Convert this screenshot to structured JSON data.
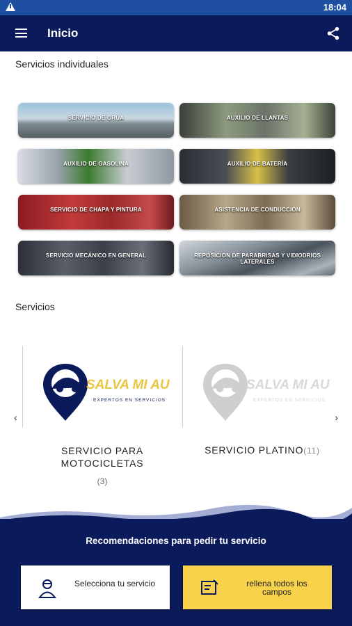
{
  "status_bar": {
    "time": "18:04"
  },
  "app_bar": {
    "title": "Inicio"
  },
  "individual_services": {
    "title": "Servicios individuales",
    "items": [
      {
        "label": "Servicio de grúa"
      },
      {
        "label": "Auxilio de llantas"
      },
      {
        "label": "Auxilio de gasolina"
      },
      {
        "label": "Auxilio de batería"
      },
      {
        "label": "Servicio de chapa y pintura"
      },
      {
        "label": "Asistencia de conducción"
      },
      {
        "label": "Servicio mecánico en general"
      },
      {
        "label": "Reposicion de parabrisas y vidiodrios laterales"
      }
    ]
  },
  "services": {
    "title": "Servicios",
    "cards": [
      {
        "name": "SERVICIO PARA MOTOCICLETAS",
        "count": "(3)",
        "logo_text": "SALVA MI AUTO",
        "logo_subtext": "EXPERTOS EN SERVICIOS"
      },
      {
        "name": "SERVICIO PLATINO",
        "count": "(11)",
        "logo_text": "SALVA MI AUTO",
        "logo_subtext": "EXPERTOS EN SERVICIOS"
      }
    ]
  },
  "footer": {
    "recommendations_title": "Recomendaciones para pedir tu servicio",
    "steps": [
      {
        "label": "Selecciona tu servicio"
      },
      {
        "label": "rellena todos los campos"
      }
    ]
  },
  "colors": {
    "navy": "#0b1a5a",
    "status_blue": "#1f4fa0",
    "yellow": "#f7d24a"
  }
}
